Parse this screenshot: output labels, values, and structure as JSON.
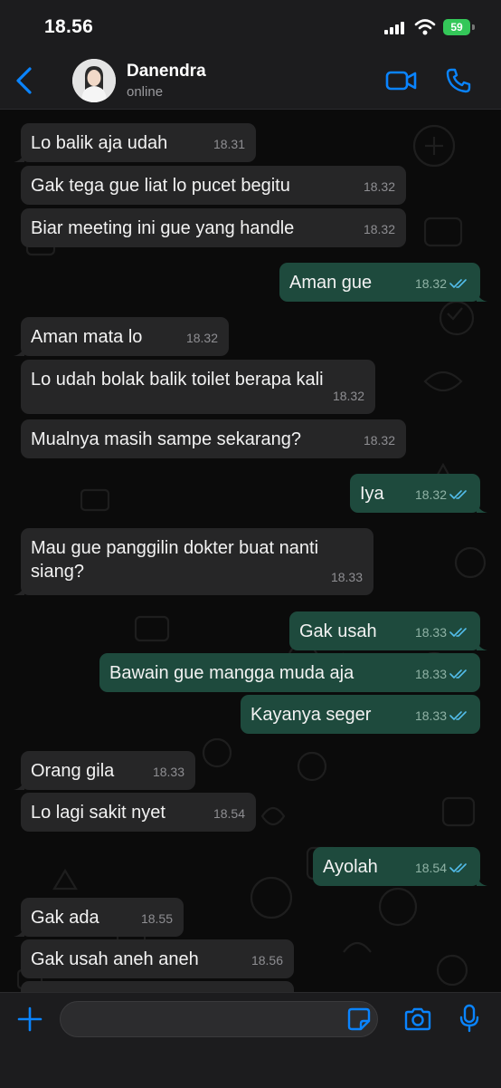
{
  "status_bar": {
    "time": "18.56",
    "battery": "59"
  },
  "header": {
    "contact_name": "Danendra",
    "contact_status": "online"
  },
  "colors": {
    "accent": "#0a84ff",
    "outgoing_bubble": "#1e4a3d",
    "incoming_bubble": "#262627",
    "read_tick": "#53bdeb"
  },
  "messages": [
    {
      "dir": "in",
      "text": "Lo balik aja udah",
      "time": "18.31"
    },
    {
      "dir": "in",
      "text": "Gak tega gue liat lo pucet begitu",
      "time": "18.32"
    },
    {
      "dir": "in",
      "text": "Biar meeting ini gue yang handle",
      "time": "18.32"
    },
    {
      "dir": "out",
      "text": "Aman gue",
      "time": "18.32"
    },
    {
      "dir": "in",
      "text": "Aman mata lo",
      "time": "18.32"
    },
    {
      "dir": "in",
      "text": "Lo udah bolak balik toilet berapa kali",
      "time": "18.32"
    },
    {
      "dir": "in",
      "text": "Mualnya masih sampe sekarang?",
      "time": "18.32"
    },
    {
      "dir": "out",
      "text": "Iya",
      "time": "18.32"
    },
    {
      "dir": "in",
      "text": "Mau gue panggilin dokter buat nanti siang?",
      "time": "18.33"
    },
    {
      "dir": "out",
      "text": "Gak usah",
      "time": "18.33"
    },
    {
      "dir": "out",
      "text": "Bawain gue mangga muda aja",
      "time": "18.33"
    },
    {
      "dir": "out",
      "text": "Kayanya seger",
      "time": "18.33"
    },
    {
      "dir": "in",
      "text": "Orang gila",
      "time": "18.33"
    },
    {
      "dir": "in",
      "text": "Lo lagi sakit nyet",
      "time": "18.54"
    },
    {
      "dir": "out",
      "text": "Ayolah",
      "time": "18.54"
    },
    {
      "dir": "in",
      "text": "Gak ada",
      "time": "18.55"
    },
    {
      "dir": "in",
      "text": "Gak usah aneh aneh",
      "time": "18.56"
    }
  ],
  "input": {
    "value": ""
  },
  "icons": {
    "back": "chevron-left-icon",
    "video": "video-camera-icon",
    "call": "phone-icon",
    "plus": "plus-icon",
    "sticker": "sticker-icon",
    "camera": "camera-icon",
    "mic": "microphone-icon"
  }
}
